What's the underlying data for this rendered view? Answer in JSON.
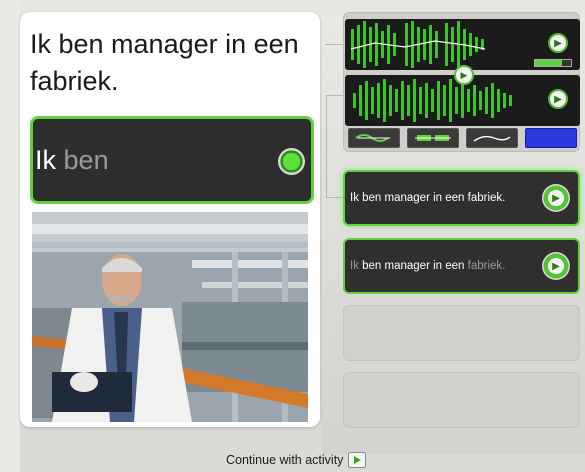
{
  "lesson": {
    "sentence": "Ik ben manager in een fabriek.",
    "speak_spoken": "Ik",
    "speak_remaining": "ben"
  },
  "waveforms": {
    "top_icon": "speaker-icon",
    "bottom_icon": "speaker-icon",
    "scrubber_icon": "speaker-icon",
    "level_fraction": 0.75,
    "modes": [
      "wave-mode",
      "pitch-mode",
      "curve-mode",
      "spectrogram-mode"
    ],
    "active_mode": "spectrogram-mode"
  },
  "phrases": [
    {
      "text": "Ik ben manager in een fabriek.",
      "state": "selected"
    },
    {
      "parts": [
        {
          "t": "Ik ",
          "dim": true
        },
        {
          "t": "ben manager in een ",
          "dim": false
        },
        {
          "t": "fabriek.",
          "dim": true
        }
      ]
    }
  ],
  "footer": {
    "continue_label": "Continue with activity"
  },
  "colors": {
    "accent_green": "#5fd240",
    "panel_dark": "#2f2f2f",
    "active_mode_blue": "#2a3adf"
  }
}
